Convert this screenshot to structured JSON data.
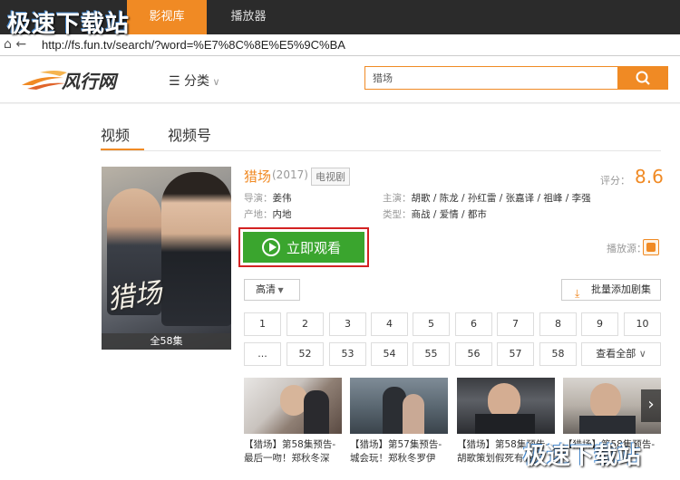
{
  "watermark": "极速下载站",
  "browser_tabs": [
    "影视库",
    "播放器"
  ],
  "address": {
    "url": "http://fs.fun.tv/search/?word=%E7%8C%8E%E5%9C%BA"
  },
  "site": {
    "logo_text": "风行网",
    "category_label": "分类",
    "search_value": "猎场"
  },
  "result_tabs": [
    "视频",
    "视频号"
  ],
  "show": {
    "title": "猎场",
    "year": "(2017)",
    "type_badge": "电视剧",
    "score_label": "评分：",
    "score": "8.6",
    "poster_title": "猎场",
    "poster_episodes": "全58集",
    "director_label": "导演：",
    "director": "姜伟",
    "region_label": "产地：",
    "region": "内地",
    "cast_label": "主演：",
    "cast": "胡歌 / 陈龙 / 孙红雷 / 张嘉译 / 祖峰 / 李强",
    "genre_label": "类型：",
    "genre": "商战 / 爱情 / 都市",
    "play_label": "立即观看",
    "source_label": "播放源："
  },
  "controls": {
    "quality": "高清",
    "batch_add": "批量添加剧集",
    "view_all": "查看全部"
  },
  "episodes_row1": [
    "1",
    "2",
    "3",
    "4",
    "5",
    "6",
    "7",
    "8",
    "9",
    "10"
  ],
  "episodes_row2": [
    "...",
    "52",
    "53",
    "54",
    "55",
    "56",
    "57",
    "58"
  ],
  "previews": [
    {
      "caption": "【猎场】第58集预告-最后一吻！郑秋冬深"
    },
    {
      "caption": "【猎场】第57集预告-城会玩！郑秋冬罗伊"
    },
    {
      "caption": "【猎场】第58集预告-胡歌策划假死有感"
    },
    {
      "caption": "【猎场】第58集预告-"
    }
  ]
}
